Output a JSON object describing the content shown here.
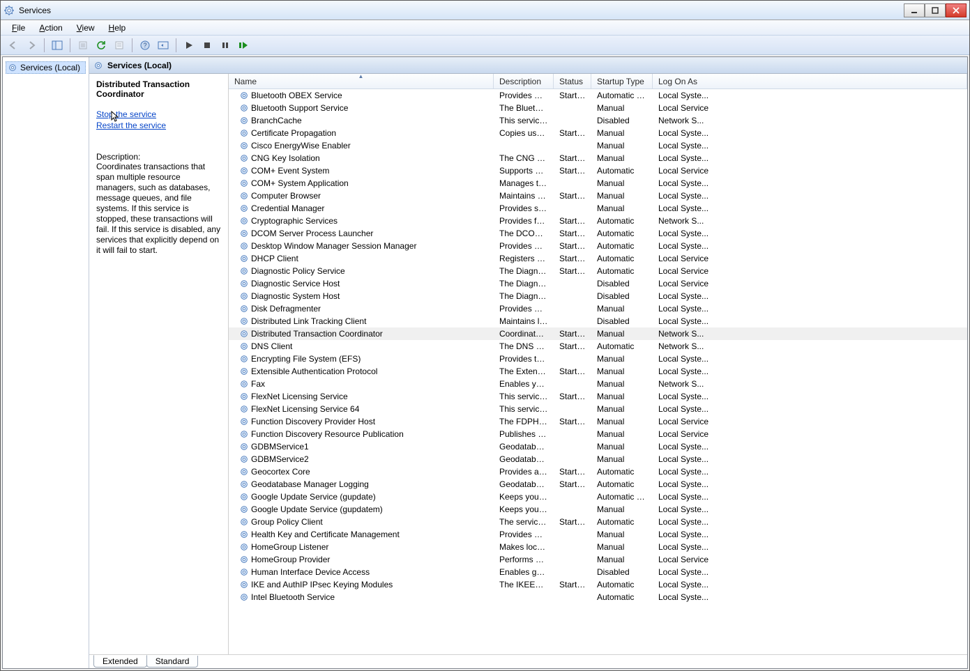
{
  "window": {
    "title": "Services"
  },
  "menubar": [
    {
      "label": "File",
      "underline": "F"
    },
    {
      "label": "Action",
      "underline": "A"
    },
    {
      "label": "View",
      "underline": "V"
    },
    {
      "label": "Help",
      "underline": "H"
    }
  ],
  "tree": {
    "root_label": "Services (Local)"
  },
  "main": {
    "header": "Services (Local)"
  },
  "detail": {
    "title": "Distributed Transaction Coordinator",
    "link_stop": "Stop the service",
    "link_restart": "Restart the service",
    "desc_label": "Description:",
    "desc": "Coordinates transactions that span multiple resource managers, such as databases, message queues, and file systems. If this service is stopped, these transactions will fail. If this service is disabled, any services that explicitly depend on it will fail to start."
  },
  "columns": {
    "name": "Name",
    "description": "Description",
    "status": "Status",
    "startup": "Startup Type",
    "logon": "Log On As"
  },
  "tabs": {
    "extended": "Extended",
    "standard": "Standard"
  },
  "selected_index": 18,
  "services": [
    {
      "name": "Bluetooth OBEX Service",
      "desc": "Provides Bl...",
      "status": "Started",
      "startup": "Automatic (D...",
      "logon": "Local Syste..."
    },
    {
      "name": "Bluetooth Support Service",
      "desc": "The Bluetoo...",
      "status": "",
      "startup": "Manual",
      "logon": "Local Service"
    },
    {
      "name": "BranchCache",
      "desc": "This service ...",
      "status": "",
      "startup": "Disabled",
      "logon": "Network S..."
    },
    {
      "name": "Certificate Propagation",
      "desc": "Copies user ...",
      "status": "Started",
      "startup": "Manual",
      "logon": "Local Syste..."
    },
    {
      "name": "Cisco EnergyWise Enabler",
      "desc": "",
      "status": "",
      "startup": "Manual",
      "logon": "Local Syste..."
    },
    {
      "name": "CNG Key Isolation",
      "desc": "The CNG ke...",
      "status": "Started",
      "startup": "Manual",
      "logon": "Local Syste..."
    },
    {
      "name": "COM+ Event System",
      "desc": "Supports Sy...",
      "status": "Started",
      "startup": "Automatic",
      "logon": "Local Service"
    },
    {
      "name": "COM+ System Application",
      "desc": "Manages th...",
      "status": "",
      "startup": "Manual",
      "logon": "Local Syste..."
    },
    {
      "name": "Computer Browser",
      "desc": "Maintains a...",
      "status": "Started",
      "startup": "Manual",
      "logon": "Local Syste..."
    },
    {
      "name": "Credential Manager",
      "desc": "Provides se...",
      "status": "",
      "startup": "Manual",
      "logon": "Local Syste..."
    },
    {
      "name": "Cryptographic Services",
      "desc": "Provides fo...",
      "status": "Started",
      "startup": "Automatic",
      "logon": "Network S..."
    },
    {
      "name": "DCOM Server Process Launcher",
      "desc": "The DCOM...",
      "status": "Started",
      "startup": "Automatic",
      "logon": "Local Syste..."
    },
    {
      "name": "Desktop Window Manager Session Manager",
      "desc": "Provides De...",
      "status": "Started",
      "startup": "Automatic",
      "logon": "Local Syste..."
    },
    {
      "name": "DHCP Client",
      "desc": "Registers an...",
      "status": "Started",
      "startup": "Automatic",
      "logon": "Local Service"
    },
    {
      "name": "Diagnostic Policy Service",
      "desc": "The Diagno...",
      "status": "Started",
      "startup": "Automatic",
      "logon": "Local Service"
    },
    {
      "name": "Diagnostic Service Host",
      "desc": "The Diagno...",
      "status": "",
      "startup": "Disabled",
      "logon": "Local Service"
    },
    {
      "name": "Diagnostic System Host",
      "desc": "The Diagno...",
      "status": "",
      "startup": "Disabled",
      "logon": "Local Syste..."
    },
    {
      "name": "Disk Defragmenter",
      "desc": "Provides Dis...",
      "status": "",
      "startup": "Manual",
      "logon": "Local Syste..."
    },
    {
      "name": "Distributed Link Tracking Client",
      "desc": "Maintains li...",
      "status": "",
      "startup": "Disabled",
      "logon": "Local Syste..."
    },
    {
      "name": "Distributed Transaction Coordinator",
      "desc": "Coordinates...",
      "status": "Started",
      "startup": "Manual",
      "logon": "Network S..."
    },
    {
      "name": "DNS Client",
      "desc": "The DNS Cli...",
      "status": "Started",
      "startup": "Automatic",
      "logon": "Network S..."
    },
    {
      "name": "Encrypting File System (EFS)",
      "desc": "Provides th...",
      "status": "",
      "startup": "Manual",
      "logon": "Local Syste..."
    },
    {
      "name": "Extensible Authentication Protocol",
      "desc": "The Extensi...",
      "status": "Started",
      "startup": "Manual",
      "logon": "Local Syste..."
    },
    {
      "name": "Fax",
      "desc": "Enables you...",
      "status": "",
      "startup": "Manual",
      "logon": "Network S..."
    },
    {
      "name": "FlexNet Licensing Service",
      "desc": "This service ...",
      "status": "Started",
      "startup": "Manual",
      "logon": "Local Syste..."
    },
    {
      "name": "FlexNet Licensing Service 64",
      "desc": "This service ...",
      "status": "",
      "startup": "Manual",
      "logon": "Local Syste..."
    },
    {
      "name": "Function Discovery Provider Host",
      "desc": "The FDPHO...",
      "status": "Started",
      "startup": "Manual",
      "logon": "Local Service"
    },
    {
      "name": "Function Discovery Resource Publication",
      "desc": "Publishes th...",
      "status": "",
      "startup": "Manual",
      "logon": "Local Service"
    },
    {
      "name": "GDBMService1",
      "desc": "Geodatabas...",
      "status": "",
      "startup": "Manual",
      "logon": "Local Syste..."
    },
    {
      "name": "GDBMService2",
      "desc": "Geodatabas...",
      "status": "",
      "startup": "Manual",
      "logon": "Local Syste..."
    },
    {
      "name": "Geocortex Core",
      "desc": "Provides a s...",
      "status": "Started",
      "startup": "Automatic",
      "logon": "Local Syste..."
    },
    {
      "name": "Geodatabase Manager Logging",
      "desc": "Geodatabas...",
      "status": "Started",
      "startup": "Automatic",
      "logon": "Local Syste..."
    },
    {
      "name": "Google Update Service (gupdate)",
      "desc": "Keeps your ...",
      "status": "",
      "startup": "Automatic (D...",
      "logon": "Local Syste..."
    },
    {
      "name": "Google Update Service (gupdatem)",
      "desc": "Keeps your ...",
      "status": "",
      "startup": "Manual",
      "logon": "Local Syste..."
    },
    {
      "name": "Group Policy Client",
      "desc": "The service ...",
      "status": "Started",
      "startup": "Automatic",
      "logon": "Local Syste..."
    },
    {
      "name": "Health Key and Certificate Management",
      "desc": "Provides X.5...",
      "status": "",
      "startup": "Manual",
      "logon": "Local Syste..."
    },
    {
      "name": "HomeGroup Listener",
      "desc": "Makes local...",
      "status": "",
      "startup": "Manual",
      "logon": "Local Syste..."
    },
    {
      "name": "HomeGroup Provider",
      "desc": "Performs ne...",
      "status": "",
      "startup": "Manual",
      "logon": "Local Service"
    },
    {
      "name": "Human Interface Device Access",
      "desc": "Enables gen...",
      "status": "",
      "startup": "Disabled",
      "logon": "Local Syste..."
    },
    {
      "name": "IKE and AuthIP IPsec Keying Modules",
      "desc": "The IKEEXT ...",
      "status": "Started",
      "startup": "Automatic",
      "logon": "Local Syste..."
    },
    {
      "name": "Intel Bluetooth Service",
      "desc": "",
      "status": "",
      "startup": "Automatic",
      "logon": "Local Syste..."
    }
  ]
}
